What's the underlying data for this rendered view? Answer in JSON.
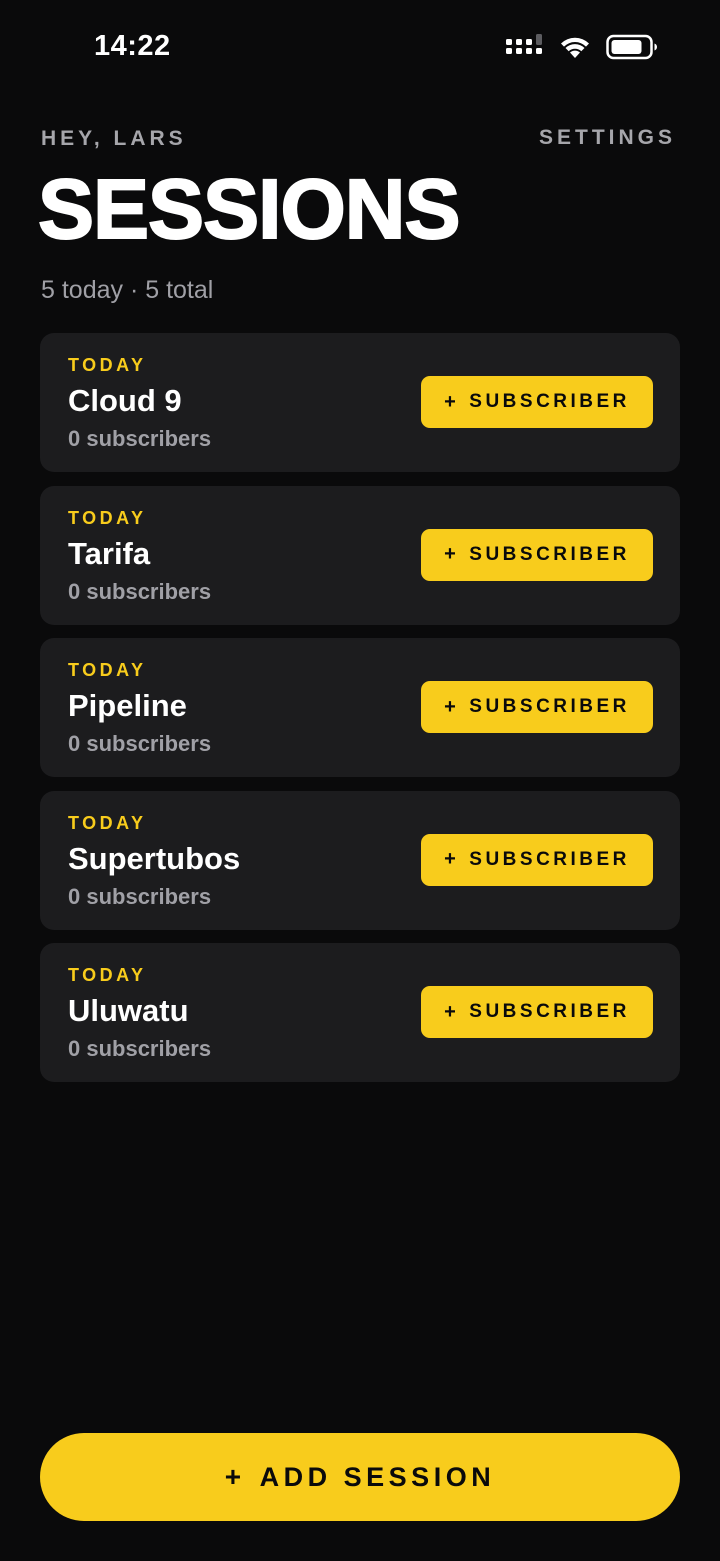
{
  "status_bar": {
    "time": "14:22",
    "icons": [
      "cellular-signal-icon",
      "wifi-icon",
      "battery-icon"
    ]
  },
  "header": {
    "greeting": "HEY, LARS",
    "settings_label": "SETTINGS",
    "title": "SESSIONS",
    "summary": "5 today · 5 total"
  },
  "sessions": [
    {
      "tag": "TODAY",
      "name": "Cloud 9",
      "count": "0 subscribers",
      "button_plus": "+",
      "button_label": "SUBSCRIBER"
    },
    {
      "tag": "TODAY",
      "name": "Tarifa",
      "count": "0 subscribers",
      "button_plus": "+",
      "button_label": "SUBSCRIBER"
    },
    {
      "tag": "TODAY",
      "name": "Pipeline",
      "count": "0 subscribers",
      "button_plus": "+",
      "button_label": "SUBSCRIBER"
    },
    {
      "tag": "TODAY",
      "name": "Supertubos",
      "count": "0 subscribers",
      "button_plus": "+",
      "button_label": "SUBSCRIBER"
    },
    {
      "tag": "TODAY",
      "name": "Uluwatu",
      "count": "0 subscribers",
      "button_plus": "+",
      "button_label": "SUBSCRIBER"
    }
  ],
  "footer": {
    "add_plus": "+",
    "add_label": "ADD SESSION"
  },
  "colors": {
    "background": "#0a0a0b",
    "card": "#1c1c1e",
    "accent": "#f8cc1c",
    "muted_text": "#a0a0a6",
    "primary_text": "#ffffff"
  }
}
